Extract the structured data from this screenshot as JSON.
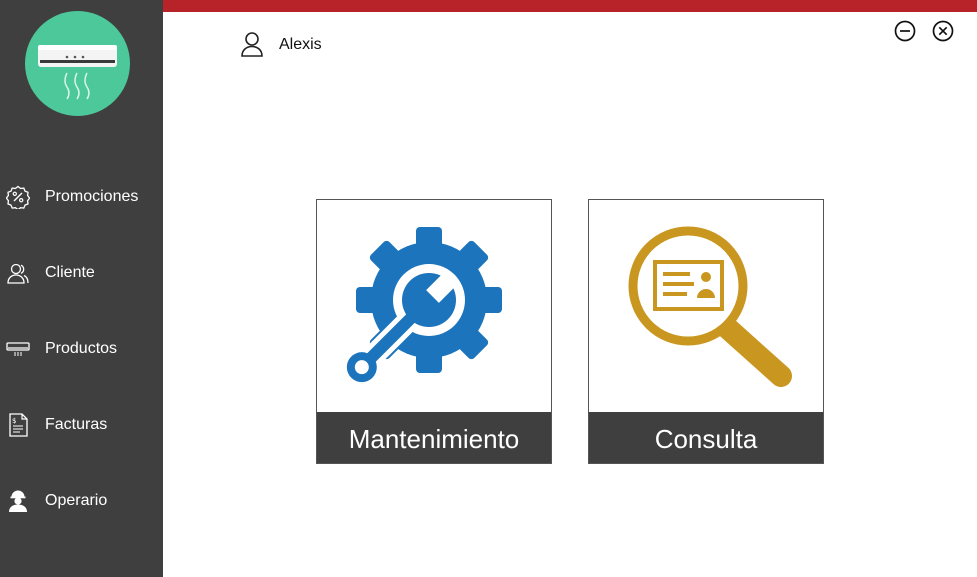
{
  "user": {
    "name": "Alexis",
    "icon": "user-icon"
  },
  "window": {
    "minimize_icon": "minimize-icon",
    "close_icon": "close-icon"
  },
  "sidebar": {
    "logo": "air-conditioner-logo",
    "items": [
      {
        "label": "Promociones",
        "icon": "percent-badge-icon"
      },
      {
        "label": "Cliente",
        "icon": "users-icon"
      },
      {
        "label": "Productos",
        "icon": "air-conditioner-icon"
      },
      {
        "label": "Facturas",
        "icon": "invoice-icon"
      },
      {
        "label": "Operario",
        "icon": "worker-icon"
      }
    ]
  },
  "main": {
    "tiles": [
      {
        "label": "Mantenimiento",
        "icon": "gear-wrench-icon"
      },
      {
        "label": "Consulta",
        "icon": "magnifier-id-card-icon"
      }
    ]
  },
  "colors": {
    "sidebar": "#3f3f3f",
    "topbar": "#b8232a",
    "logo": "#4cc89a",
    "maintenance_icon": "#1c75bc",
    "consulta_icon": "#c9961f"
  }
}
